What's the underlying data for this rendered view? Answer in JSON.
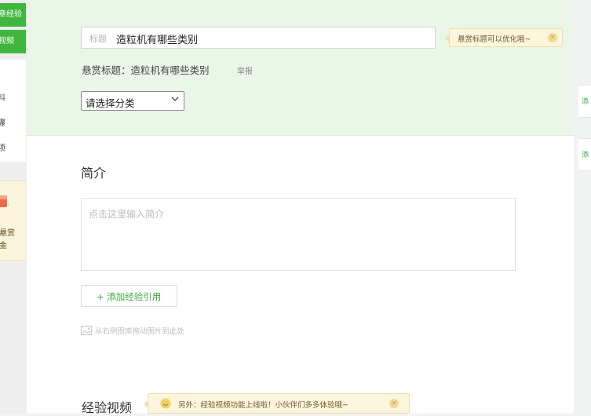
{
  "sidebar": {
    "green_buttons": [
      "章经验",
      "视频"
    ],
    "items": [
      "",
      "料",
      "骤",
      "项"
    ],
    "promo": {
      "line1": "悬赏",
      "line2": "金"
    }
  },
  "title_field": {
    "prefix": "标题",
    "value": "造粒机有哪些类别"
  },
  "title_tip": {
    "text": "悬赏标题可以优化哦~"
  },
  "bounty": {
    "label": "悬赏标题：造粒机有哪些类别",
    "report": "举报"
  },
  "category": {
    "selected": "请选择分类"
  },
  "intro": {
    "heading": "简介",
    "placeholder": "点击这里输入简介"
  },
  "add_reference": {
    "label": "+ 添加经验引用"
  },
  "drag_hint": {
    "text": "从右侧图库拖动图片到此处"
  },
  "video": {
    "heading": "经验视频",
    "tip": "另外：经验视频功能上线啦！小伙伴们多多体验哦~"
  },
  "right_cards": [
    "添",
    "添"
  ],
  "colors": {
    "accent_green": "#3fb63f",
    "panel_green": "#eaf6e8",
    "tip_yellow": "#fdf5dc"
  }
}
